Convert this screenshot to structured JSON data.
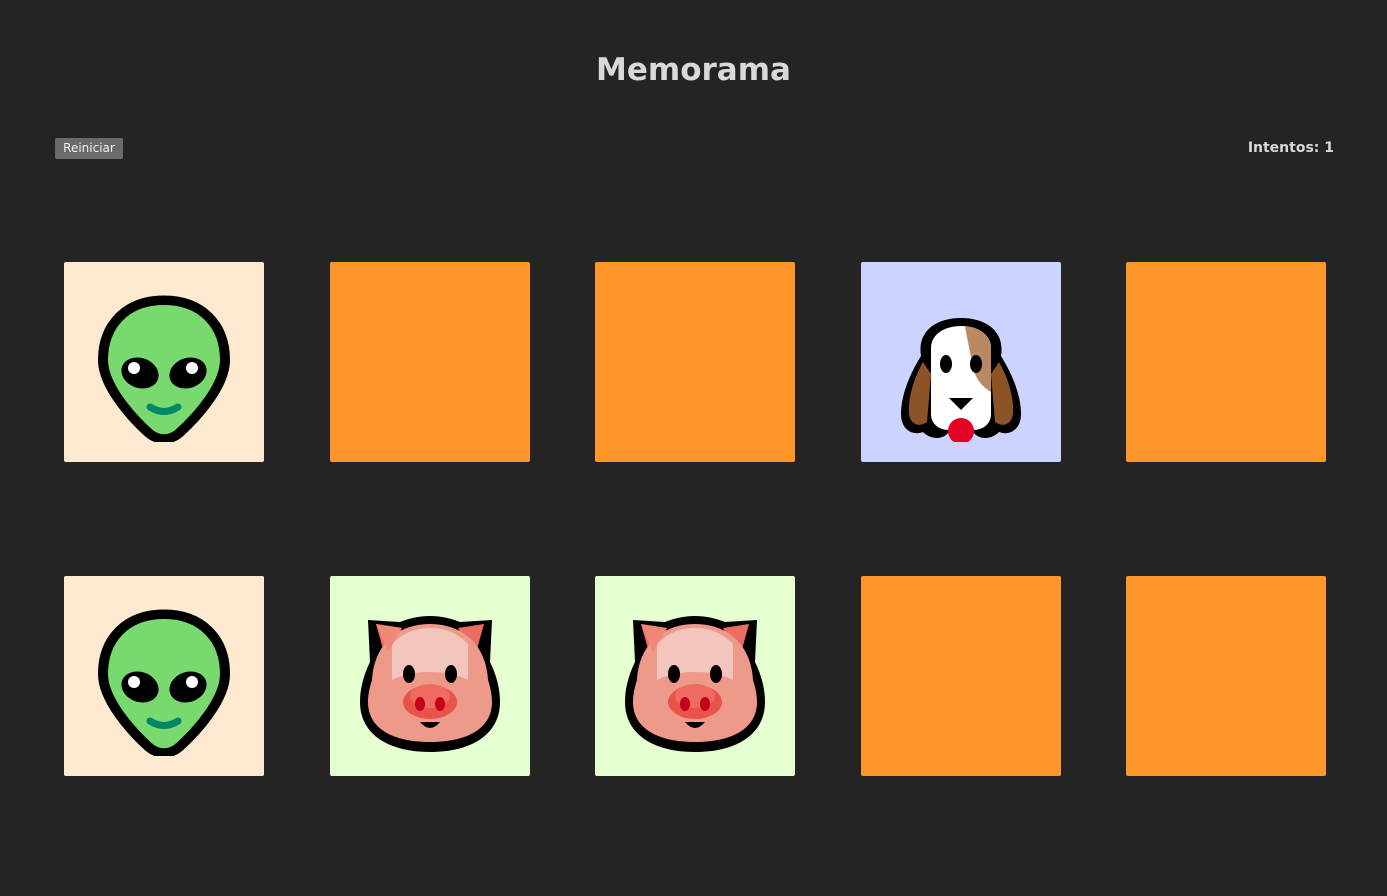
{
  "header": {
    "title": "Memorama"
  },
  "controls": {
    "restart_label": "Reiniciar",
    "attempts_label": "Intentos: 1"
  },
  "colors": {
    "background": "#242424",
    "card_back": "#fe962a",
    "alien_card_bg": "#ffe9d0",
    "dog_card_bg": "#cdd3ff",
    "pig_card_bg": "#e5ffd0"
  },
  "board": {
    "columns": 5,
    "rows": 2,
    "cards": [
      {
        "state": "revealed",
        "icon": "alien-icon",
        "bg": "#ffe9d0"
      },
      {
        "state": "hidden",
        "icon": "",
        "bg": "#fe962a"
      },
      {
        "state": "hidden",
        "icon": "",
        "bg": "#fe962a"
      },
      {
        "state": "revealed",
        "icon": "dog-icon",
        "bg": "#cdd3ff"
      },
      {
        "state": "hidden",
        "icon": "",
        "bg": "#fe962a"
      },
      {
        "state": "revealed",
        "icon": "alien-icon",
        "bg": "#ffe9d0"
      },
      {
        "state": "revealed",
        "icon": "pig-icon",
        "bg": "#e5ffd0"
      },
      {
        "state": "revealed",
        "icon": "pig-icon",
        "bg": "#e5ffd0"
      },
      {
        "state": "hidden",
        "icon": "",
        "bg": "#fe962a"
      },
      {
        "state": "hidden",
        "icon": "",
        "bg": "#fe962a"
      }
    ]
  }
}
